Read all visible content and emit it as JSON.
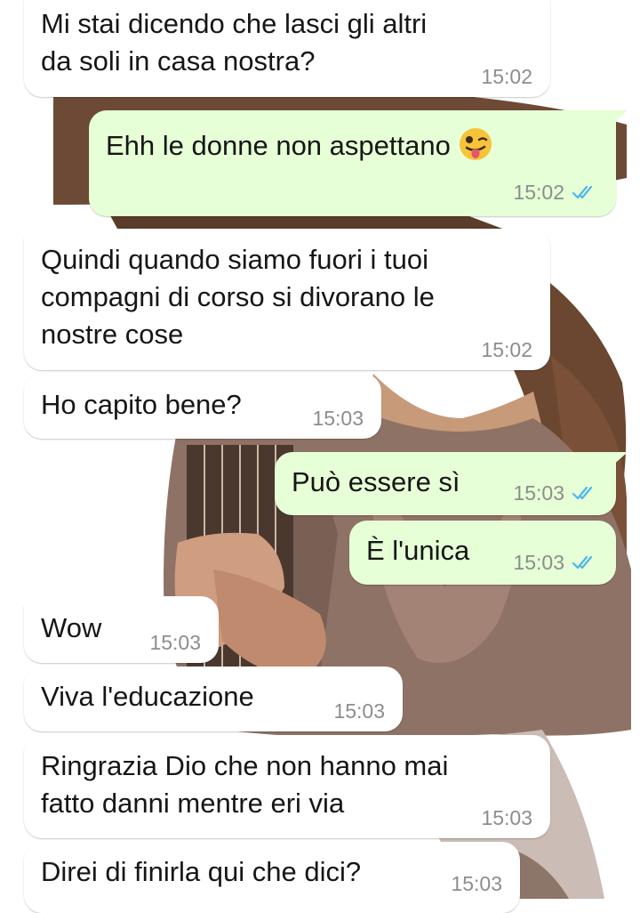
{
  "chat": {
    "messages": [
      {
        "direction": "in",
        "text": "Mi stai dicendo che lasci gli altri\nda soli in casa nostra?",
        "time": "15:02"
      },
      {
        "direction": "out",
        "text": "Ehh le donne non aspettano",
        "emoji": "winking-face-with-tongue-icon",
        "time": "15:02",
        "status": "read"
      },
      {
        "direction": "in",
        "text": "Quindi quando siamo fuori i tuoi\ncompagni di corso si divorano le\nnostre cose",
        "time": "15:02"
      },
      {
        "direction": "in",
        "text": "Ho capito bene?",
        "time": "15:03"
      },
      {
        "direction": "out",
        "text": "Può essere sì",
        "time": "15:03",
        "status": "read"
      },
      {
        "direction": "out",
        "text": "È l'unica",
        "time": "15:03",
        "status": "read"
      },
      {
        "direction": "in",
        "text": "Wow",
        "time": "15:03"
      },
      {
        "direction": "in",
        "text": "Viva l'educazione",
        "time": "15:03"
      },
      {
        "direction": "in",
        "text": "Ringrazia Dio che non hanno mai\nfatto danni mentre eri via",
        "time": "15:03"
      },
      {
        "direction": "in",
        "text": "Direi di finirla qui che dici?",
        "time": "15:03"
      }
    ]
  },
  "colors": {
    "incoming_bubble": "#ffffff",
    "outgoing_bubble": "#e6ffd6",
    "read_ticks": "#4fb6ec",
    "timestamp": "#8d8d8d"
  }
}
